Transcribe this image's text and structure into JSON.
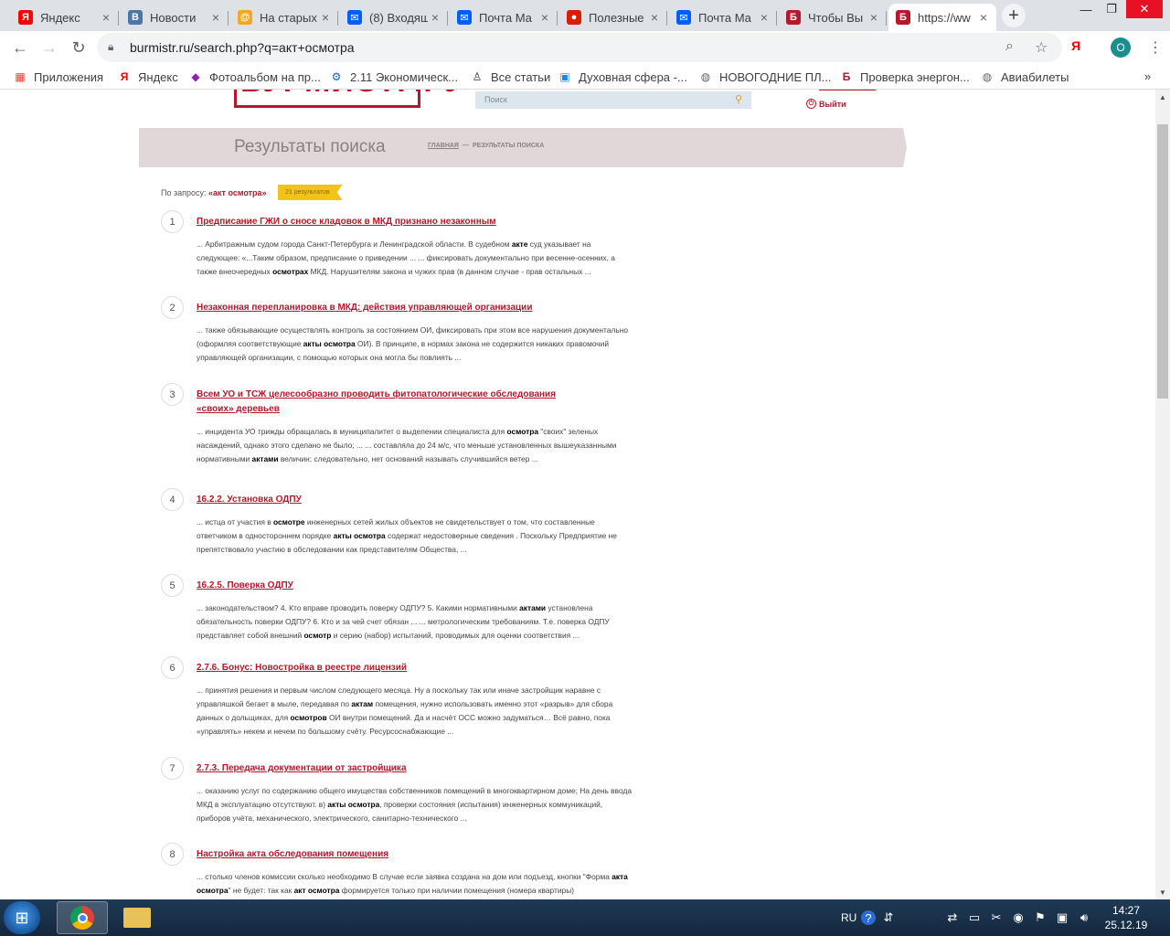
{
  "browser": {
    "tabs": [
      {
        "title": "Яндекс",
        "icon": "yandex-icon",
        "color": "#ff0000",
        "glyph": "Я"
      },
      {
        "title": "Новости",
        "icon": "vk-icon",
        "color": "#4a76a8",
        "glyph": "В"
      },
      {
        "title": "На старых",
        "icon": "mail-at-icon",
        "color": "#f5a623",
        "glyph": "@"
      },
      {
        "title": "(8) Входящ",
        "icon": "mail-icon",
        "color": "#005ff9",
        "glyph": "✉"
      },
      {
        "title": "Почта Ма",
        "icon": "mail-icon",
        "color": "#005ff9",
        "glyph": "✉"
      },
      {
        "title": "Полезные",
        "icon": "red-ball-icon",
        "color": "#d81e05",
        "glyph": "●"
      },
      {
        "title": "Почта Ма",
        "icon": "mail-icon",
        "color": "#005ff9",
        "glyph": "✉"
      },
      {
        "title": "Чтобы Вы",
        "icon": "burmistr-icon",
        "color": "#b5172d",
        "glyph": "Б"
      },
      {
        "title": "https://ww",
        "icon": "burmistr-icon",
        "color": "#b5172d",
        "glyph": "Б"
      }
    ],
    "close_glyph": "×",
    "new_tab_glyph": "+",
    "url": "burmistr.ru/search.php?q=акт+осмотра",
    "profile_letter": "O",
    "yandex_ext": "Я",
    "bookmarks": [
      {
        "label": "Приложения",
        "icon": "apps-grid-icon",
        "glyph": "▦",
        "color": "#ea4335"
      },
      {
        "label": "Яндекс",
        "icon": "yandex-icon",
        "glyph": "Я",
        "color": "#ff0000"
      },
      {
        "label": "Фотоальбом на пр...",
        "icon": "photo-icon",
        "glyph": "◆",
        "color": "#8e24aa"
      },
      {
        "label": "2.11 Экономическ...",
        "icon": "gear-icon",
        "glyph": "⚙",
        "color": "#1565c0"
      },
      {
        "label": "Все статьи",
        "icon": "person-icon",
        "glyph": "♙",
        "color": "#333333"
      },
      {
        "label": "Духовная сфера -...",
        "icon": "page-icon",
        "glyph": "▣",
        "color": "#1e88e5"
      },
      {
        "label": "НОВОГОДНИЕ ПЛ...",
        "icon": "globe-icon",
        "glyph": "◍",
        "color": "#5f6368"
      },
      {
        "label": "Проверка энергон...",
        "icon": "burmistr-icon",
        "glyph": "Б",
        "color": "#b5172d"
      },
      {
        "label": "Авиабилеты",
        "icon": "globe-icon",
        "glyph": "◍",
        "color": "#5f6368"
      }
    ],
    "bookmarks_more": "»"
  },
  "site": {
    "logo": "БУРМИСТР.РУ",
    "search_placeholder": "Поиск",
    "logout": "Выйти",
    "page_title": "Результаты поиска",
    "breadcrumb_home": "ГЛАВНАЯ",
    "breadcrumb_sep": "—",
    "breadcrumb_current": "РЕЗУЛЬТАТЫ ПОИСКА",
    "query_prefix": "По запросу:",
    "query": "«акт осмотра»",
    "result_count": "21 результатов"
  },
  "results": [
    {
      "num": "1",
      "title": "Предписание ГЖИ о сносе кладовок в МКД признано незаконным",
      "snippet": "... Арбитражным судом города Санкт-Петербурга и Ленинградской области. В судебном <b>акте</b> суд указывает на следующее: «...Таким образом, предписание о приведении ... ... фиксировать документально при весенне-осенних, а также внеочередных <b>осмотрах</b> МКД. Нарушителям закона и чужих прав (в данном случае - прав остальных ..."
    },
    {
      "num": "2",
      "title": "Незаконная перепланировка в МКД: действия управляющей организации",
      "snippet": "... также обязывающие осуществлять контроль за состоянием ОИ, фиксировать при этом все нарушения документально (оформляя соответствующие <b>акты осмотра</b> ОИ). В принципе, в нормах закона не содержится никаких правомочий управляющей организации, с помощью которых она могла бы повлиять ..."
    },
    {
      "num": "3",
      "title": "Всем УО и ТСЖ целесообразно проводить фитопатологические обследования «своих» деревьев",
      "snippet": "... инцидента УО трижды обращалась в муниципалитет о выделении специалиста для <b>осмотра</b> \"своих\" зеленых насаждений, однако этого сделано не было; ... ... составляла до 24 м/с, что меньше установленных вышеуказанными нормативными <b>актами</b> величин; следовательно, нет оснований называть случившийся ветер ..."
    },
    {
      "num": "4",
      "title": "16.2.2. Установка ОДПУ",
      "snippet": "... истца от участия в <b>осмотре</b> инженерных сетей жилых объектов не свидетельствует о том, что составленные ответчиком в одностороннем порядке <b>акты осмотра</b> содержат недостоверные сведения . Поскольку Предприятие не препятствовало участию в обследовании как представителям Общества, ..."
    },
    {
      "num": "5",
      "title": "16.2.5. Поверка ОДПУ",
      "snippet": "... законодательством? 4. Кто вправе проводить поверку ОДПУ? 5. Какими нормативными <b>актами</b> установлена обязательность поверки ОДПУ? 6. Кто и за чей счет обязан ... ... метрологическим требованиям. Т.е. поверка ОДПУ представляет собой внешний <b>осмотр</b> и серию (набор) испытаний, проводимых для оценки соответствия ..."
    },
    {
      "num": "6",
      "title": "2.7.6. Бонус: Новостройка в реестре лицензий",
      "snippet": "... принятия решения и первым числом следующего месяца. Ну а поскольку так или иначе застройщик наравне с управляшкой бегает в мыле, передавая по <b>актам</b> помещения, нужно использовать именно этот «разрыв» для сбора данных о дольщиках, для <b>осмотров</b> ОИ внутри помещений. Да и насчёт ОСС можно задуматься… Всё равно, пока «управлять» некем и нечем по большому счёту. Ресурсоснабжающие ..."
    },
    {
      "num": "7",
      "title": "2.7.3. Передача документации от застройщика",
      "snippet": "... оказанию услуг по содержанию общего имущества собственников помещений в многоквартирном доме; На день ввода МКД в эксплуатацию отсутствуют. в) <b>акты осмотра</b>, проверки состояния (испытания) инженерных коммуникаций, приборов учёта, механического, электрического, санитарно-технического ..."
    },
    {
      "num": "8",
      "title": "Настройка акта обследования помещения",
      "snippet": "... столько членов комиссии сколько необходимо В случае если заявка создана на дом или подъезд, кнопки \"Форма <b>акта осмотра</b>\" не будет: так как <b>акт осмотра</b> формируется только при наличии помещения (номера квартиры)"
    }
  ],
  "taskbar": {
    "lang": "RU",
    "time": "14:27",
    "date": "25.12.19"
  }
}
